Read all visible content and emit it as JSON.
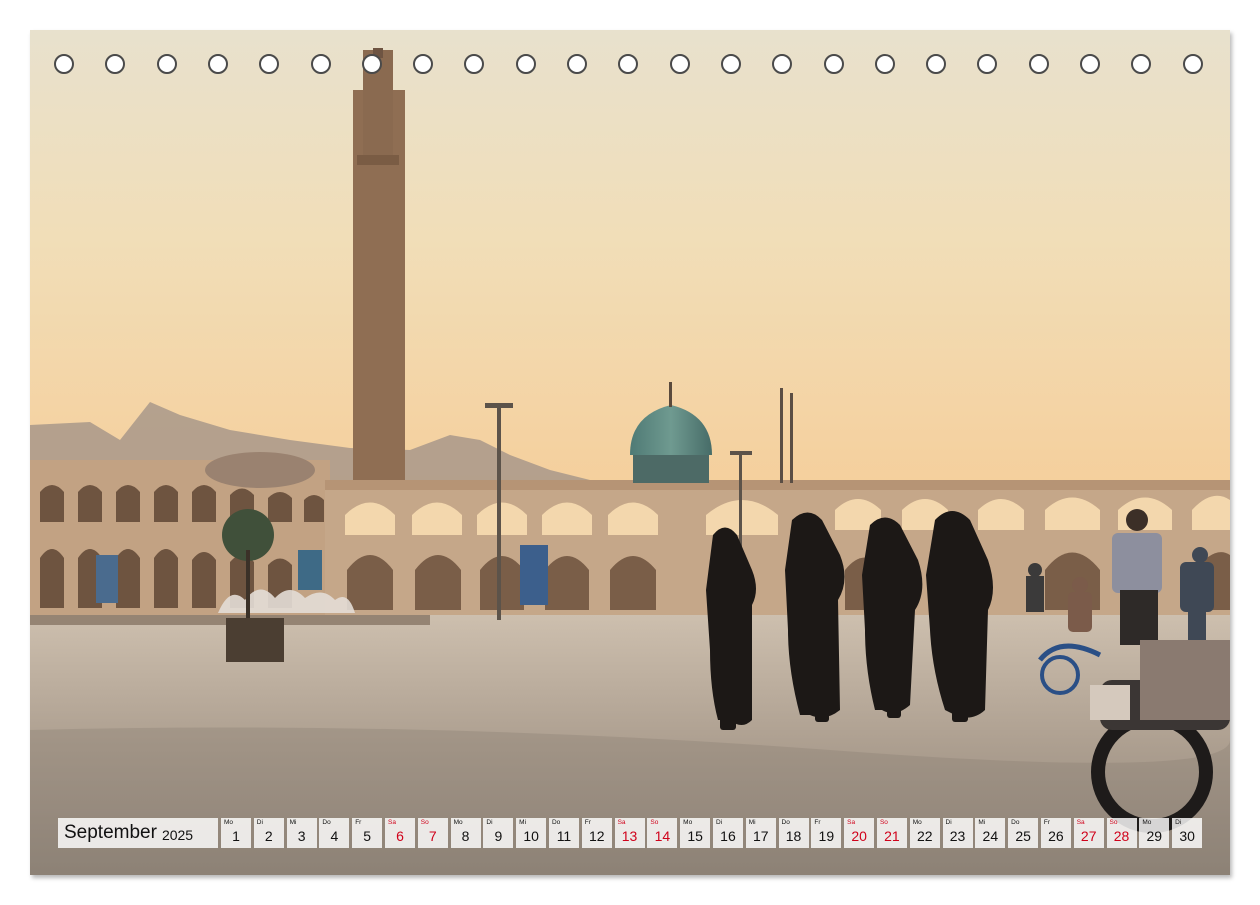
{
  "colors": {
    "sky_top": "#e9e2cf",
    "sky_horizon": "#f3d3a4",
    "ground": "#b3a89a",
    "arcade": "#c8a98a",
    "weekend_red": "#d0021b"
  },
  "ring_holes_count": 23,
  "calendar": {
    "month": "September",
    "year": "2025",
    "days": [
      {
        "wd": "Mo",
        "d": "1"
      },
      {
        "wd": "Di",
        "d": "2"
      },
      {
        "wd": "Mi",
        "d": "3"
      },
      {
        "wd": "Do",
        "d": "4"
      },
      {
        "wd": "Fr",
        "d": "5"
      },
      {
        "wd": "Sa",
        "d": "6",
        "we": true
      },
      {
        "wd": "So",
        "d": "7",
        "we": true
      },
      {
        "wd": "Mo",
        "d": "8"
      },
      {
        "wd": "Di",
        "d": "9"
      },
      {
        "wd": "Mi",
        "d": "10"
      },
      {
        "wd": "Do",
        "d": "11"
      },
      {
        "wd": "Fr",
        "d": "12"
      },
      {
        "wd": "Sa",
        "d": "13",
        "we": true
      },
      {
        "wd": "So",
        "d": "14",
        "we": true
      },
      {
        "wd": "Mo",
        "d": "15"
      },
      {
        "wd": "Di",
        "d": "16"
      },
      {
        "wd": "Mi",
        "d": "17"
      },
      {
        "wd": "Do",
        "d": "18"
      },
      {
        "wd": "Fr",
        "d": "19"
      },
      {
        "wd": "Sa",
        "d": "20",
        "we": true
      },
      {
        "wd": "So",
        "d": "21",
        "we": true
      },
      {
        "wd": "Mo",
        "d": "22"
      },
      {
        "wd": "Di",
        "d": "23"
      },
      {
        "wd": "Mi",
        "d": "24"
      },
      {
        "wd": "Do",
        "d": "25"
      },
      {
        "wd": "Fr",
        "d": "26"
      },
      {
        "wd": "Sa",
        "d": "27",
        "we": true
      },
      {
        "wd": "So",
        "d": "28",
        "we": true
      },
      {
        "wd": "Mo",
        "d": "29"
      },
      {
        "wd": "Di",
        "d": "30"
      }
    ]
  }
}
